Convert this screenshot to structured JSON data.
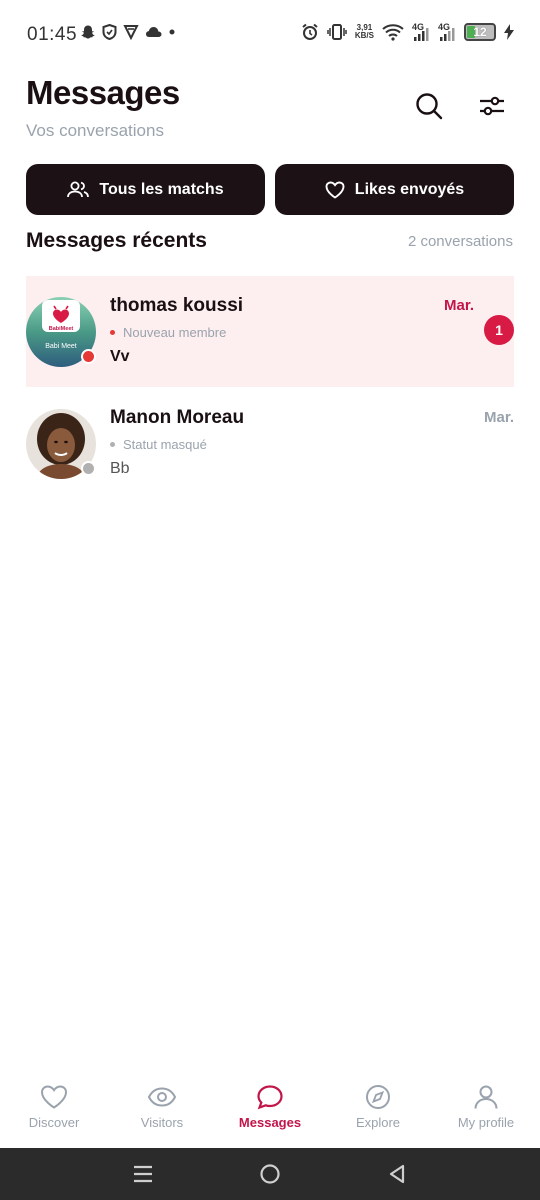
{
  "status_bar": {
    "time": "01:45",
    "speed_value": "3,91",
    "speed_unit": "KB/S",
    "network_1": "4G",
    "network_2": "4G",
    "battery": "12"
  },
  "header": {
    "title": "Messages",
    "subtitle": "Vos conversations",
    "search_icon": "search-icon",
    "filter_icon": "sliders-icon"
  },
  "actions": {
    "matches_label": "Tous les matchs",
    "likes_label": "Likes envoyés"
  },
  "section": {
    "title": "Messages récents",
    "count": "2 conversations"
  },
  "conversations": [
    {
      "name": "thomas koussi",
      "status": "Nouveau membre",
      "preview": "Vv",
      "date": "Mar.",
      "unread": "1",
      "avatar_caption": "Babi Meet",
      "avatar_logo_text": "BabiMeet",
      "presence_color": "#e53935",
      "highlighted": true
    },
    {
      "name": "Manon Moreau",
      "status": "Statut masqué",
      "preview": "Bb",
      "date": "Mar.",
      "presence_color": "#b0b0b0",
      "highlighted": false
    }
  ],
  "bottom_nav": [
    {
      "label": "Discover",
      "icon": "heart-icon",
      "active": false
    },
    {
      "label": "Visitors",
      "icon": "eye-icon",
      "active": false
    },
    {
      "label": "Messages",
      "icon": "chat-bubble-icon",
      "active": true
    },
    {
      "label": "Explore",
      "icon": "compass-icon",
      "active": false
    },
    {
      "label": "My profile",
      "icon": "user-icon",
      "active": false
    }
  ],
  "colors": {
    "accent": "#c2164a",
    "dark": "#1c1115",
    "muted": "#9aa3ad",
    "highlight_bg": "#fdeef0",
    "badge": "#d81b45"
  }
}
